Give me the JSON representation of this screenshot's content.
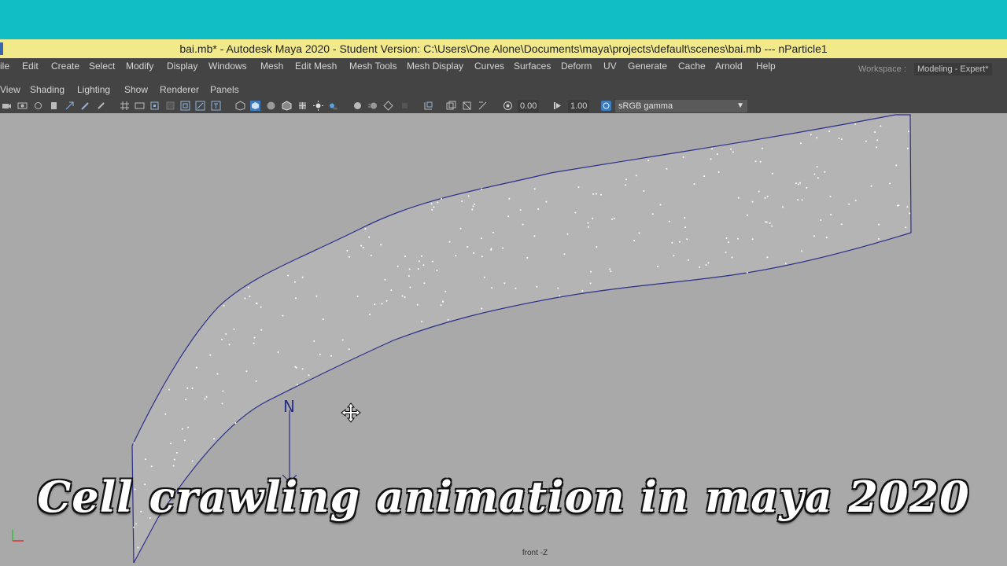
{
  "window": {
    "title": "bai.mb* - Autodesk Maya 2020 - Student Version: C:\\Users\\One Alone\\Documents\\maya\\projects\\default\\scenes\\bai.mb   ---   nParticle1"
  },
  "menubar": {
    "items": [
      "ile",
      "Edit",
      "Create",
      "Select",
      "Modify",
      "Display",
      "Windows",
      "Mesh",
      "Edit Mesh",
      "Mesh Tools",
      "Mesh Display",
      "Curves",
      "Surfaces",
      "Deform",
      "UV",
      "Generate",
      "Cache",
      "Arnold",
      "Help"
    ],
    "workspace_label": "Workspace :",
    "workspace_value": "Modeling - Expert*"
  },
  "panel_menu": {
    "items": [
      "View",
      "Shading",
      "Lighting",
      "Show",
      "Renderer",
      "Panels"
    ]
  },
  "toolbar": {
    "exposure": "0.00",
    "gamma": "1.00",
    "color_space": "sRGB gamma"
  },
  "viewport": {
    "camera_label": "front -Z",
    "normal_marker": "N"
  },
  "caption": "Cell crawling animation in maya 2020",
  "colors": {
    "accent_cyan": "#12bec6",
    "title_yellow": "#f1e98a",
    "ui_dark": "#444444",
    "viewport_gray": "#a9a9a9",
    "curve_blue": "#2a2f8a"
  }
}
